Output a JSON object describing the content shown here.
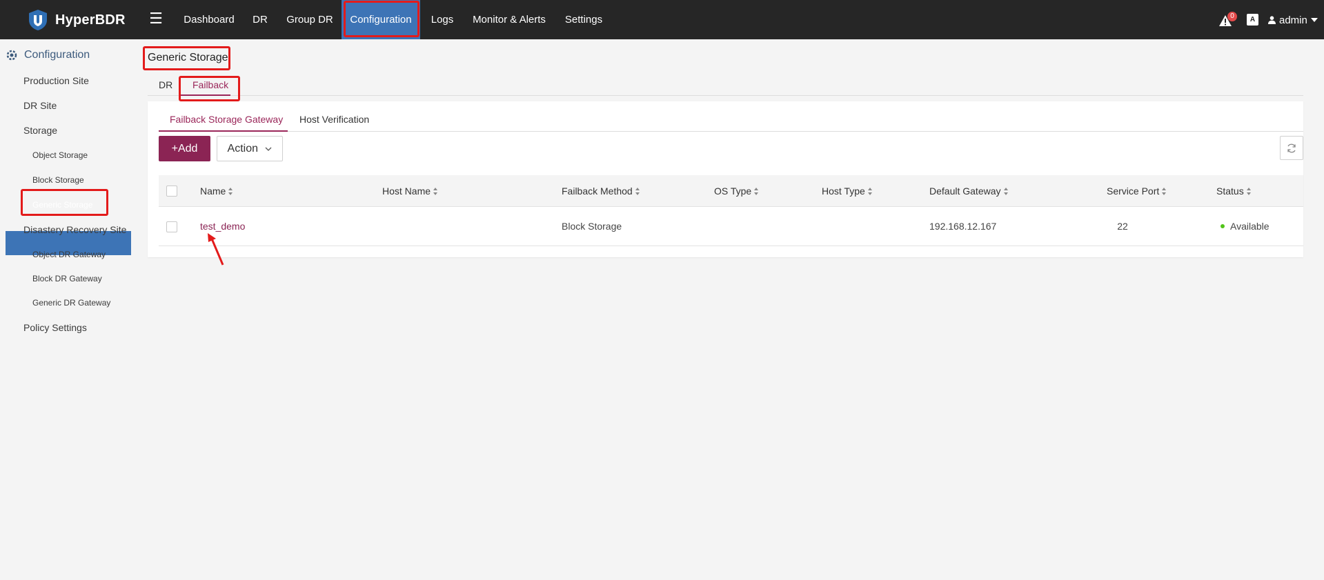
{
  "app": {
    "name": "HyperBDR"
  },
  "nav": {
    "items": [
      {
        "label": "Dashboard"
      },
      {
        "label": "DR"
      },
      {
        "label": "Group DR"
      },
      {
        "label": "Configuration"
      },
      {
        "label": "Logs"
      },
      {
        "label": "Monitor & Alerts"
      },
      {
        "label": "Settings"
      }
    ],
    "alert_count": "0",
    "lang_icon_text": "A",
    "user": "admin"
  },
  "sidebar": {
    "header": "Configuration",
    "items": [
      {
        "label": "Production Site"
      },
      {
        "label": "DR Site"
      },
      {
        "label": "Storage"
      },
      {
        "label": "Object Storage"
      },
      {
        "label": "Block Storage"
      },
      {
        "label": "Generic Storage"
      },
      {
        "label": "Disastery Recovery Site"
      },
      {
        "label": "Object DR Gateway"
      },
      {
        "label": "Block DR Gateway"
      },
      {
        "label": "Generic DR Gateway"
      },
      {
        "label": "Policy Settings"
      }
    ]
  },
  "page": {
    "title": "Generic Storage",
    "tabs": [
      {
        "label": "DR"
      },
      {
        "label": "Failback"
      }
    ],
    "sub_tabs": [
      {
        "label": "Failback Storage Gateway"
      },
      {
        "label": "Host Verification"
      }
    ]
  },
  "toolbar": {
    "add_label": "+Add",
    "action_label": "Action"
  },
  "table": {
    "columns": [
      "Name",
      "Host Name",
      "Failback Method",
      "OS Type",
      "Host Type",
      "Default Gateway",
      "Service Port",
      "Status"
    ],
    "rows": [
      {
        "name": "test_demo",
        "host_name": "",
        "failback_method": "Block Storage",
        "os_type": "",
        "host_type": "",
        "default_gateway": "192.168.12.167",
        "service_port": "22",
        "status": "Available"
      }
    ]
  },
  "colors": {
    "accent": "#8b2454",
    "nav_active": "#3d74b6",
    "status_ok": "#52c41a",
    "highlight": "#e31b1b"
  }
}
